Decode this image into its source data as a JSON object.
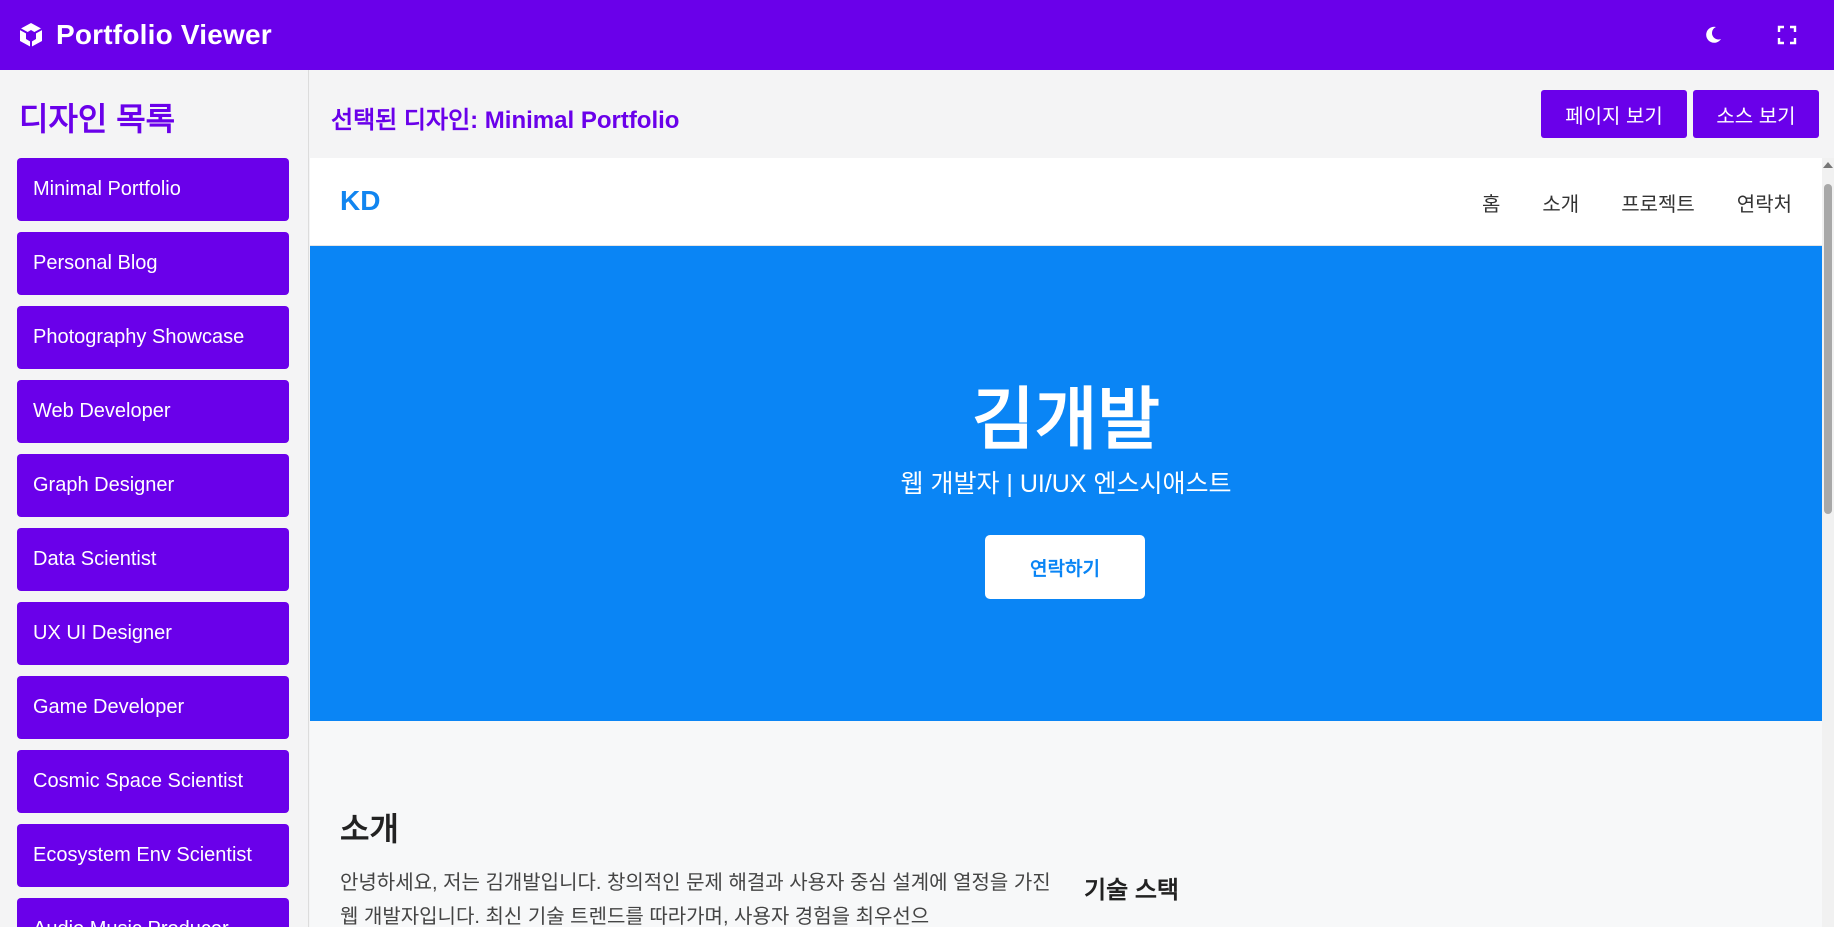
{
  "app": {
    "title": "Portfolio Viewer",
    "brand_color": "#6a00ea",
    "icons": {
      "logo": "cube-icon",
      "theme": "moon-icon",
      "fullscreen": "fullscreen-icon"
    }
  },
  "sidebar": {
    "title": "디자인 목록",
    "items": [
      {
        "label": "Minimal Portfolio"
      },
      {
        "label": "Personal Blog"
      },
      {
        "label": "Photography Showcase"
      },
      {
        "label": "Web Developer"
      },
      {
        "label": "Graph Designer"
      },
      {
        "label": "Data Scientist"
      },
      {
        "label": "UX UI Designer"
      },
      {
        "label": "Game Developer"
      },
      {
        "label": "Cosmic Space Scientist"
      },
      {
        "label": "Ecosystem Env Scientist"
      },
      {
        "label": "Audio Music Producer"
      }
    ]
  },
  "main": {
    "selected_label": "선택된 디자인: Minimal Portfolio",
    "view_page_label": "페이지 보기",
    "view_source_label": "소스 보기"
  },
  "preview": {
    "brand": "KD",
    "nav": [
      "홈",
      "소개",
      "프로젝트",
      "연락처"
    ],
    "hero": {
      "name": "김개발",
      "tagline": "웹 개발자 | UI/UX 엔스시애스트",
      "cta": "연락하기",
      "bg_color": "#0a85f5"
    },
    "about": {
      "title": "소개",
      "text": "안녕하세요, 저는 김개발입니다. 창의적인 문제 해결과 사용자 중심 설계에 열정을 가진 웹 개발자입니다. 최신 기술 트렌드를 따라가며, 사용자 경험을 최우선으"
    },
    "skills_title": "기술 스택"
  }
}
